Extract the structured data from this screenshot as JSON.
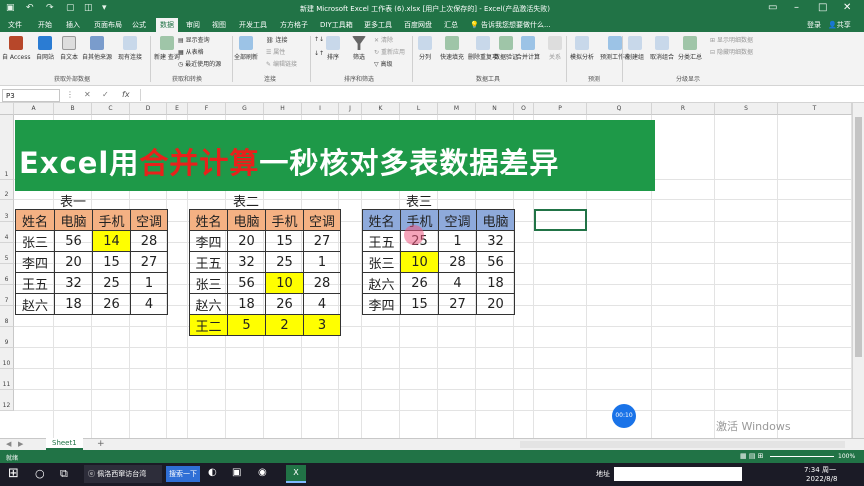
{
  "window": {
    "title": "新建 Microsoft Excel 工作表 (6).xlsx [用户上次保存的] - Excel(产品激活失败)",
    "login": "登录",
    "share": "共享"
  },
  "tabs": [
    "文件",
    "开始",
    "插入",
    "页面布局",
    "公式",
    "数据",
    "审阅",
    "视图",
    "开发工具",
    "方方格子",
    "DIY工具箱",
    "更多工具",
    "百度网盘",
    "汇总",
    "告诉我您想要做什么..."
  ],
  "ribbon": {
    "external": [
      "自 Access",
      "自网站",
      "自文本",
      "自其他来源",
      "现有连接"
    ],
    "external_group": "获取外部数据",
    "new_query": "新建\n查询",
    "query_small": [
      "显示查询",
      "从表格",
      "最近使用的源"
    ],
    "get_group": "获取和转换",
    "refresh_all": "全部刷新",
    "conn_small": [
      "连接",
      "属性",
      "编辑链接"
    ],
    "conn_group": "连接",
    "sort_small": [
      "↑↓",
      "↓↑"
    ],
    "sort": "排序",
    "filter": "筛选",
    "filter_small": [
      "清除",
      "重新应用",
      "高级"
    ],
    "sort_group": "排序和筛选",
    "tools": [
      "分列",
      "快速填充",
      "删除重复项",
      "数据验证",
      "合并计算",
      "关系"
    ],
    "tools_group": "数据工具",
    "forecast": [
      "模拟分析",
      "预测工作表"
    ],
    "forecast_group": "预测",
    "outline": [
      "创建组",
      "取消组合",
      "分类汇总"
    ],
    "outline_small": [
      "显示明细数据",
      "隐藏明细数据"
    ],
    "outline_group": "分级显示"
  },
  "formula": {
    "namebox": "P3",
    "fx": "fx",
    "value": ""
  },
  "columns": [
    "A",
    "B",
    "C",
    "D",
    "E",
    "F",
    "G",
    "H",
    "I",
    "J",
    "K",
    "L",
    "M",
    "N",
    "O",
    "P",
    "Q",
    "R",
    "S",
    "T"
  ],
  "rows": [
    "1",
    "2",
    "3",
    "4",
    "5",
    "6",
    "7",
    "8",
    "9",
    "10",
    "11",
    "12"
  ],
  "banner": {
    "part1": "Excel用",
    "part2": "合并计算",
    "part3": "一秒核对多表数据差异"
  },
  "tables": [
    {
      "caption": "表一",
      "header": [
        "姓名",
        "电脑",
        "手机",
        "空调"
      ],
      "rows": [
        [
          "张三",
          "56",
          "14",
          "28"
        ],
        [
          "李四",
          "20",
          "15",
          "27"
        ],
        [
          "王五",
          "32",
          "25",
          "1"
        ],
        [
          "赵六",
          "18",
          "26",
          "4"
        ]
      ]
    },
    {
      "caption": "表二",
      "header": [
        "姓名",
        "电脑",
        "手机",
        "空调"
      ],
      "rows": [
        [
          "李四",
          "20",
          "15",
          "27"
        ],
        [
          "王五",
          "32",
          "25",
          "1"
        ],
        [
          "张三",
          "56",
          "10",
          "28"
        ],
        [
          "赵六",
          "18",
          "26",
          "4"
        ],
        [
          "王二",
          "5",
          "2",
          "3"
        ]
      ]
    },
    {
      "caption": "表三",
      "header": [
        "姓名",
        "手机",
        "空调",
        "电脑"
      ],
      "rows": [
        [
          "王五",
          "25",
          "1",
          "32"
        ],
        [
          "张三",
          "10",
          "28",
          "56"
        ],
        [
          "赵六",
          "26",
          "4",
          "18"
        ],
        [
          "李四",
          "15",
          "27",
          "20"
        ]
      ]
    }
  ],
  "colors": {
    "excel_green": "#217346",
    "banner": "#1e9948",
    "banner_red": "#e8211b",
    "hdr_orange": "#f4b183",
    "hdr_blue": "#8eaadb",
    "highlight": "#ffff00"
  },
  "sheet": {
    "tab": "Sheet1",
    "add": "+"
  },
  "status": {
    "ready": "就绪",
    "zoom": "100%"
  },
  "timer": "00:10",
  "watermark": "激活 Windows",
  "taskbar": {
    "app1": "佩洛西窜访台湾",
    "search": "搜索一下",
    "place": "地址",
    "time": "7:34 周一",
    "date": "2022/8/8"
  }
}
